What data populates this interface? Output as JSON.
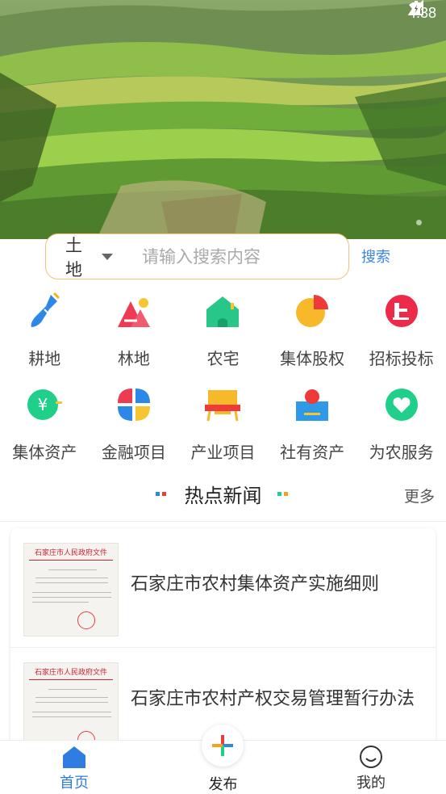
{
  "status_bar": {
    "time": "4:38",
    "icons": [
      "wifi-icon",
      "signal-icon",
      "battery-icon"
    ]
  },
  "search": {
    "category": "土地",
    "placeholder": "请输入搜索内容",
    "button": "搜索"
  },
  "categories": [
    {
      "label": "耕地",
      "icon": "shovel-icon"
    },
    {
      "label": "林地",
      "icon": "forest-icon"
    },
    {
      "label": "农宅",
      "icon": "house-icon"
    },
    {
      "label": "集体股权",
      "icon": "pie-chart-icon"
    },
    {
      "label": "招标投标",
      "icon": "gavel-icon"
    },
    {
      "label": "集体资产",
      "icon": "yuan-coin-icon"
    },
    {
      "label": "金融项目",
      "icon": "finance-petals-icon"
    },
    {
      "label": "产业项目",
      "icon": "industry-table-icon"
    },
    {
      "label": "社有资产",
      "icon": "assets-box-icon"
    },
    {
      "label": "为农服务",
      "icon": "heart-service-icon"
    }
  ],
  "news": {
    "title": "热点新闻",
    "more": "更多",
    "items": [
      {
        "headline": "石家庄市农村集体资产实施细则",
        "doc_header": "石家庄市人民政府文件"
      },
      {
        "headline": "石家庄市农村产权交易管理暂行办法",
        "doc_header": "石家庄市人民政府文件"
      }
    ]
  },
  "bottom_nav": {
    "home": "首页",
    "publish": "发布",
    "mine": "我的"
  },
  "colors": {
    "accent_blue": "#2f7de1",
    "search_border": "#f0c27a",
    "search_button": "#3a86e8"
  }
}
